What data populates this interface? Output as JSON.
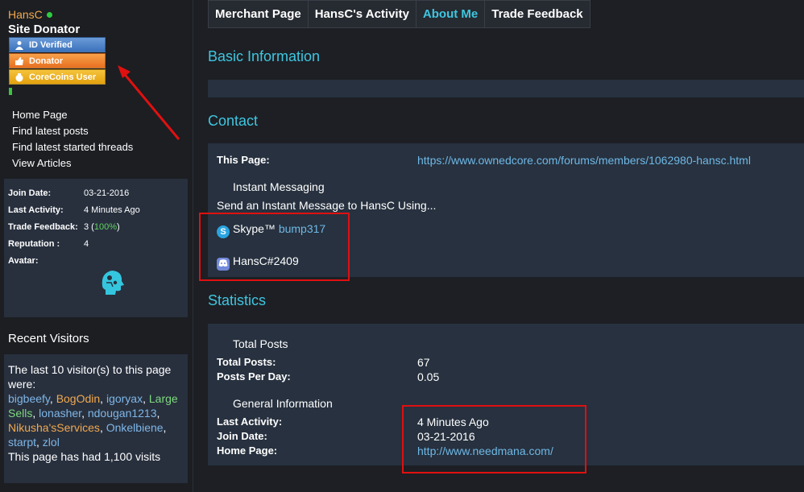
{
  "sidebar": {
    "username": "HansC",
    "user_title": "Site Donator",
    "badges": [
      {
        "label": "ID Verified",
        "icon": "person-icon"
      },
      {
        "label": "Donator",
        "icon": "thumbs-up-icon"
      },
      {
        "label": "CoreCoins User",
        "icon": "coin-bag-icon"
      }
    ],
    "links": [
      "Home Page",
      "Find latest posts",
      "Find latest started threads",
      "View Articles"
    ],
    "info": {
      "join_date_label": "Join Date:",
      "join_date": "03-21-2016",
      "last_activity_label": "Last Activity:",
      "last_activity": "4 Minutes Ago",
      "trade_feedback_label": "Trade Feedback:",
      "trade_feedback_count": "3",
      "trade_feedback_pct": "100%",
      "reputation_label": "Reputation :",
      "reputation": "4",
      "avatar_label": "Avatar:"
    },
    "visitors": {
      "title": "Recent Visitors",
      "intro": "The last 10 visitor(s) to this page were:",
      "names": [
        {
          "name": "bigbeefy",
          "color": "blue"
        },
        {
          "name": "BogOdin",
          "color": "orange"
        },
        {
          "name": "igoryax",
          "color": "blue"
        },
        {
          "name": "Large Sells",
          "color": "green"
        },
        {
          "name": "lonasher",
          "color": "blue"
        },
        {
          "name": "ndougan1213",
          "color": "blue"
        },
        {
          "name": "Nikusha'sServices",
          "color": "orange"
        },
        {
          "name": "Onkelbiene",
          "color": "blue"
        },
        {
          "name": "starpt",
          "color": "blue"
        },
        {
          "name": "zlol",
          "color": "blue"
        }
      ],
      "footer": "This page has had 1,100 visits"
    }
  },
  "tabs": [
    {
      "label": "Merchant Page",
      "active": false
    },
    {
      "label": "HansC's Activity",
      "active": false
    },
    {
      "label": "About Me",
      "active": true
    },
    {
      "label": "Trade Feedback",
      "active": false
    }
  ],
  "basic_info": {
    "title": "Basic Information"
  },
  "contact": {
    "title": "Contact",
    "this_page_label": "This Page:",
    "this_page_url": "https://www.ownedcore.com/forums/members/1062980-hansc.html",
    "im_heading": "Instant Messaging",
    "im_intro": "Send an Instant Message to HansC Using...",
    "skype_label": "Skype™",
    "skype_value": "bump317",
    "discord_value": "HansC#2409"
  },
  "statistics": {
    "title": "Statistics",
    "total_posts_heading": "Total Posts",
    "total_posts_label": "Total Posts:",
    "total_posts": "67",
    "posts_per_day_label": "Posts Per Day:",
    "posts_per_day": "0.05",
    "general_heading": "General Information",
    "last_activity_label": "Last Activity:",
    "last_activity": "4 Minutes Ago",
    "join_date_label": "Join Date:",
    "join_date": "03-21-2016",
    "home_page_label": "Home Page:",
    "home_page": "http://www.needmana.com/"
  },
  "colors": {
    "accent": "#3fc6e0",
    "panel": "#27313f",
    "background": "#1d1f24",
    "annotation": "#e01010"
  }
}
